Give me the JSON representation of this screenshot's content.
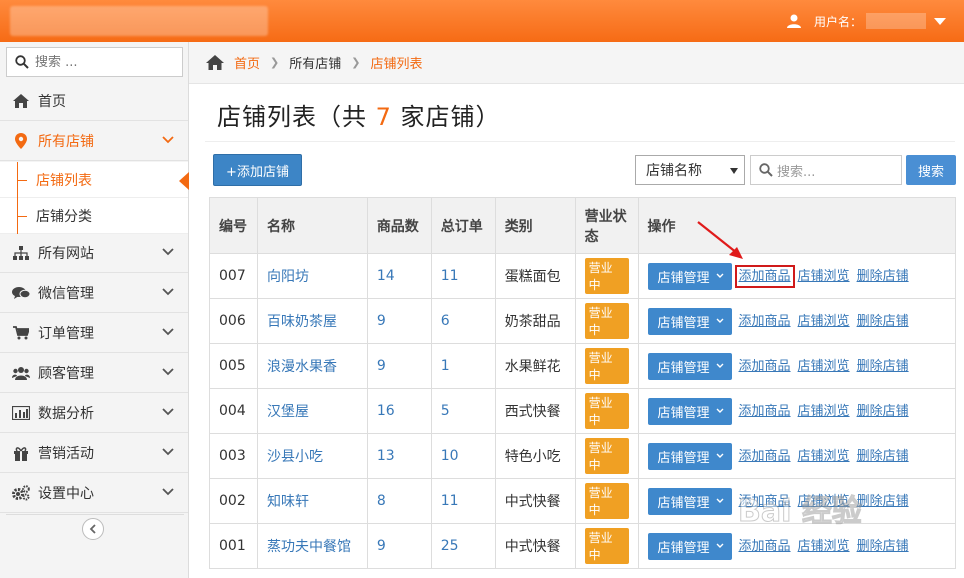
{
  "header": {
    "user_label": "用户名："
  },
  "sidebar": {
    "search_placeholder": "搜索 ...",
    "items": [
      {
        "label": "首页",
        "icon": "home-icon"
      },
      {
        "label": "所有店铺",
        "icon": "map-pin-icon",
        "active": true
      },
      {
        "label": "所有网站",
        "icon": "sitemap-icon"
      },
      {
        "label": "微信管理",
        "icon": "chat-icon"
      },
      {
        "label": "订单管理",
        "icon": "cart-icon"
      },
      {
        "label": "顾客管理",
        "icon": "users-icon"
      },
      {
        "label": "数据分析",
        "icon": "bar-chart-icon"
      },
      {
        "label": "营销活动",
        "icon": "gift-icon"
      },
      {
        "label": "设置中心",
        "icon": "gears-icon"
      }
    ],
    "subitems": [
      {
        "label": "店铺列表",
        "current": true
      },
      {
        "label": "店铺分类"
      }
    ]
  },
  "breadcrumb": {
    "home": "首页",
    "level1": "所有店铺",
    "level2": "店铺列表"
  },
  "page": {
    "title_prefix": "店铺列表（共 ",
    "count": "7",
    "title_suffix": " 家店铺）",
    "add_button": "+添加店铺",
    "select_value": "店铺名称",
    "search_placeholder": "搜索...",
    "search_button": "搜索"
  },
  "table": {
    "headers": [
      "编号",
      "名称",
      "商品数",
      "总订单",
      "类别",
      "营业状态",
      "操作"
    ],
    "rows": [
      {
        "id": "007",
        "name": "向阳坊",
        "goods": "14",
        "orders": "11",
        "category": "蛋糕面包",
        "status": "营业中"
      },
      {
        "id": "006",
        "name": "百味奶茶屋",
        "goods": "9",
        "orders": "6",
        "category": "奶茶甜品",
        "status": "营业中"
      },
      {
        "id": "005",
        "name": "浪漫水果香",
        "goods": "9",
        "orders": "1",
        "category": "水果鲜花",
        "status": "营业中"
      },
      {
        "id": "004",
        "name": "汉堡屋",
        "goods": "16",
        "orders": "5",
        "category": "西式快餐",
        "status": "营业中"
      },
      {
        "id": "003",
        "name": "沙县小吃",
        "goods": "13",
        "orders": "10",
        "category": "特色小吃",
        "status": "营业中"
      },
      {
        "id": "002",
        "name": "知味轩",
        "goods": "8",
        "orders": "11",
        "category": "中式快餐",
        "status": "营业中"
      },
      {
        "id": "001",
        "name": "蒸功夫中餐馆",
        "goods": "9",
        "orders": "25",
        "category": "中式快餐",
        "status": "营业中"
      }
    ],
    "actions": {
      "manage": "店铺管理",
      "add_goods": "添加商品",
      "browse": "店铺浏览",
      "delete": "删除店铺"
    }
  },
  "watermark": "Bai 经验",
  "colors": {
    "accent": "#f36a12",
    "primary": "#3f88cc",
    "badge": "#f0a023",
    "highlight": "#d01a1a"
  }
}
